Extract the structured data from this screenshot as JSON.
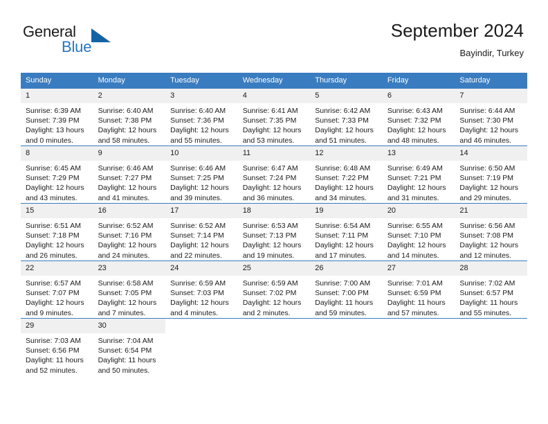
{
  "brand": {
    "word_one": "General",
    "word_two": "Blue",
    "flag_icon": "blue-triangle-flag-icon"
  },
  "header": {
    "title": "September 2024",
    "location": "Bayindir, Turkey"
  },
  "calendar": {
    "weekdays": [
      "Sunday",
      "Monday",
      "Tuesday",
      "Wednesday",
      "Thursday",
      "Friday",
      "Saturday"
    ],
    "accent_color": "#3a7cc0",
    "daynum_background": "#f0f0f0",
    "weeks": [
      [
        {
          "day": "1",
          "sunrise": "Sunrise: 6:39 AM",
          "sunset": "Sunset: 7:39 PM",
          "daylight_1": "Daylight: 13 hours",
          "daylight_2": "and 0 minutes."
        },
        {
          "day": "2",
          "sunrise": "Sunrise: 6:40 AM",
          "sunset": "Sunset: 7:38 PM",
          "daylight_1": "Daylight: 12 hours",
          "daylight_2": "and 58 minutes."
        },
        {
          "day": "3",
          "sunrise": "Sunrise: 6:40 AM",
          "sunset": "Sunset: 7:36 PM",
          "daylight_1": "Daylight: 12 hours",
          "daylight_2": "and 55 minutes."
        },
        {
          "day": "4",
          "sunrise": "Sunrise: 6:41 AM",
          "sunset": "Sunset: 7:35 PM",
          "daylight_1": "Daylight: 12 hours",
          "daylight_2": "and 53 minutes."
        },
        {
          "day": "5",
          "sunrise": "Sunrise: 6:42 AM",
          "sunset": "Sunset: 7:33 PM",
          "daylight_1": "Daylight: 12 hours",
          "daylight_2": "and 51 minutes."
        },
        {
          "day": "6",
          "sunrise": "Sunrise: 6:43 AM",
          "sunset": "Sunset: 7:32 PM",
          "daylight_1": "Daylight: 12 hours",
          "daylight_2": "and 48 minutes."
        },
        {
          "day": "7",
          "sunrise": "Sunrise: 6:44 AM",
          "sunset": "Sunset: 7:30 PM",
          "daylight_1": "Daylight: 12 hours",
          "daylight_2": "and 46 minutes."
        }
      ],
      [
        {
          "day": "8",
          "sunrise": "Sunrise: 6:45 AM",
          "sunset": "Sunset: 7:29 PM",
          "daylight_1": "Daylight: 12 hours",
          "daylight_2": "and 43 minutes."
        },
        {
          "day": "9",
          "sunrise": "Sunrise: 6:46 AM",
          "sunset": "Sunset: 7:27 PM",
          "daylight_1": "Daylight: 12 hours",
          "daylight_2": "and 41 minutes."
        },
        {
          "day": "10",
          "sunrise": "Sunrise: 6:46 AM",
          "sunset": "Sunset: 7:25 PM",
          "daylight_1": "Daylight: 12 hours",
          "daylight_2": "and 39 minutes."
        },
        {
          "day": "11",
          "sunrise": "Sunrise: 6:47 AM",
          "sunset": "Sunset: 7:24 PM",
          "daylight_1": "Daylight: 12 hours",
          "daylight_2": "and 36 minutes."
        },
        {
          "day": "12",
          "sunrise": "Sunrise: 6:48 AM",
          "sunset": "Sunset: 7:22 PM",
          "daylight_1": "Daylight: 12 hours",
          "daylight_2": "and 34 minutes."
        },
        {
          "day": "13",
          "sunrise": "Sunrise: 6:49 AM",
          "sunset": "Sunset: 7:21 PM",
          "daylight_1": "Daylight: 12 hours",
          "daylight_2": "and 31 minutes."
        },
        {
          "day": "14",
          "sunrise": "Sunrise: 6:50 AM",
          "sunset": "Sunset: 7:19 PM",
          "daylight_1": "Daylight: 12 hours",
          "daylight_2": "and 29 minutes."
        }
      ],
      [
        {
          "day": "15",
          "sunrise": "Sunrise: 6:51 AM",
          "sunset": "Sunset: 7:18 PM",
          "daylight_1": "Daylight: 12 hours",
          "daylight_2": "and 26 minutes."
        },
        {
          "day": "16",
          "sunrise": "Sunrise: 6:52 AM",
          "sunset": "Sunset: 7:16 PM",
          "daylight_1": "Daylight: 12 hours",
          "daylight_2": "and 24 minutes."
        },
        {
          "day": "17",
          "sunrise": "Sunrise: 6:52 AM",
          "sunset": "Sunset: 7:14 PM",
          "daylight_1": "Daylight: 12 hours",
          "daylight_2": "and 22 minutes."
        },
        {
          "day": "18",
          "sunrise": "Sunrise: 6:53 AM",
          "sunset": "Sunset: 7:13 PM",
          "daylight_1": "Daylight: 12 hours",
          "daylight_2": "and 19 minutes."
        },
        {
          "day": "19",
          "sunrise": "Sunrise: 6:54 AM",
          "sunset": "Sunset: 7:11 PM",
          "daylight_1": "Daylight: 12 hours",
          "daylight_2": "and 17 minutes."
        },
        {
          "day": "20",
          "sunrise": "Sunrise: 6:55 AM",
          "sunset": "Sunset: 7:10 PM",
          "daylight_1": "Daylight: 12 hours",
          "daylight_2": "and 14 minutes."
        },
        {
          "day": "21",
          "sunrise": "Sunrise: 6:56 AM",
          "sunset": "Sunset: 7:08 PM",
          "daylight_1": "Daylight: 12 hours",
          "daylight_2": "and 12 minutes."
        }
      ],
      [
        {
          "day": "22",
          "sunrise": "Sunrise: 6:57 AM",
          "sunset": "Sunset: 7:07 PM",
          "daylight_1": "Daylight: 12 hours",
          "daylight_2": "and 9 minutes."
        },
        {
          "day": "23",
          "sunrise": "Sunrise: 6:58 AM",
          "sunset": "Sunset: 7:05 PM",
          "daylight_1": "Daylight: 12 hours",
          "daylight_2": "and 7 minutes."
        },
        {
          "day": "24",
          "sunrise": "Sunrise: 6:59 AM",
          "sunset": "Sunset: 7:03 PM",
          "daylight_1": "Daylight: 12 hours",
          "daylight_2": "and 4 minutes."
        },
        {
          "day": "25",
          "sunrise": "Sunrise: 6:59 AM",
          "sunset": "Sunset: 7:02 PM",
          "daylight_1": "Daylight: 12 hours",
          "daylight_2": "and 2 minutes."
        },
        {
          "day": "26",
          "sunrise": "Sunrise: 7:00 AM",
          "sunset": "Sunset: 7:00 PM",
          "daylight_1": "Daylight: 11 hours",
          "daylight_2": "and 59 minutes."
        },
        {
          "day": "27",
          "sunrise": "Sunrise: 7:01 AM",
          "sunset": "Sunset: 6:59 PM",
          "daylight_1": "Daylight: 11 hours",
          "daylight_2": "and 57 minutes."
        },
        {
          "day": "28",
          "sunrise": "Sunrise: 7:02 AM",
          "sunset": "Sunset: 6:57 PM",
          "daylight_1": "Daylight: 11 hours",
          "daylight_2": "and 55 minutes."
        }
      ],
      [
        {
          "day": "29",
          "sunrise": "Sunrise: 7:03 AM",
          "sunset": "Sunset: 6:56 PM",
          "daylight_1": "Daylight: 11 hours",
          "daylight_2": "and 52 minutes."
        },
        {
          "day": "30",
          "sunrise": "Sunrise: 7:04 AM",
          "sunset": "Sunset: 6:54 PM",
          "daylight_1": "Daylight: 11 hours",
          "daylight_2": "and 50 minutes."
        },
        null,
        null,
        null,
        null,
        null
      ]
    ]
  }
}
